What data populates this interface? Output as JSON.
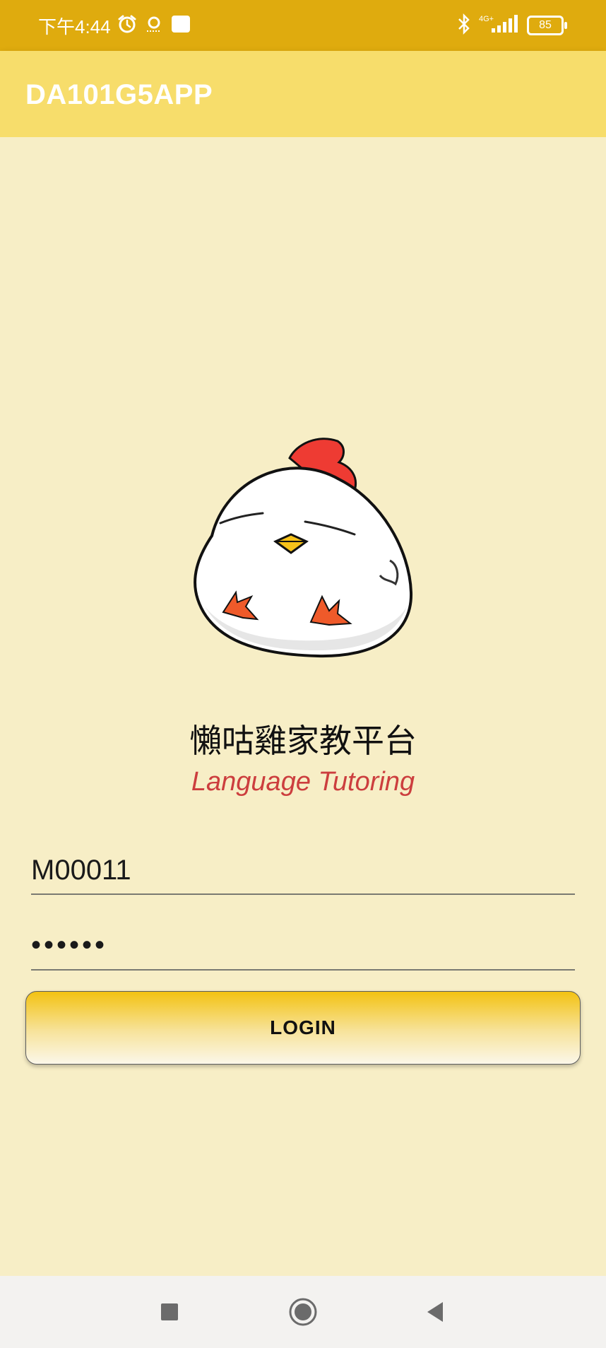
{
  "status_bar": {
    "time": "下午4:44",
    "network_label": "4G+",
    "battery": "85",
    "icons": [
      "alarm-icon",
      "notification-icon",
      "square-icon",
      "bluetooth-icon",
      "signal-icon",
      "battery-icon"
    ]
  },
  "app_bar": {
    "title": "DA101G5APP"
  },
  "brand": {
    "title_cn": "懶咕雞家教平台",
    "subtitle_en": "Language Tutoring"
  },
  "login": {
    "username_value": "M00011",
    "password_value": "••••••",
    "login_label": "LOGIN"
  },
  "nav_bar": {
    "icons": [
      "recents-icon",
      "home-icon",
      "back-icon"
    ]
  },
  "colors": {
    "status_bar": "#dfab0e",
    "app_bar": "#f7dd6b",
    "background": "#f7eec6",
    "accent_text": "#cc3e3e",
    "button_top": "#f3c212"
  }
}
